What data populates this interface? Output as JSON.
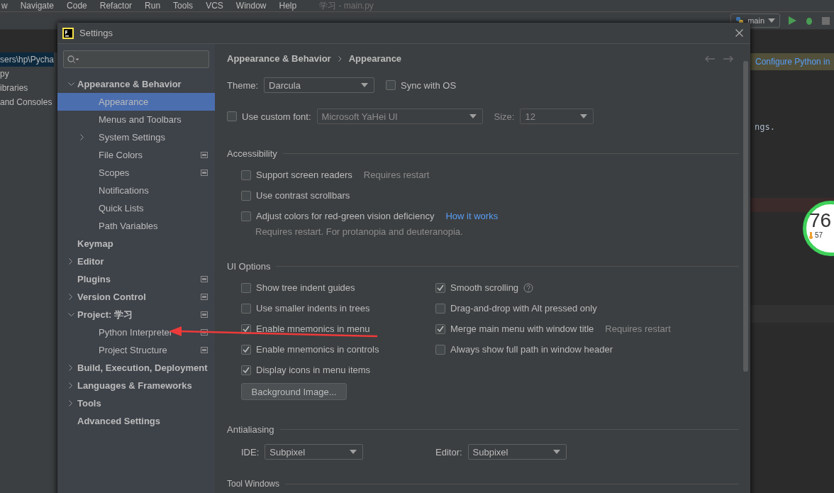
{
  "ide": {
    "menu": [
      "w",
      "Navigate",
      "Code",
      "Refactor",
      "Run",
      "Tools",
      "VCS",
      "Window",
      "Help"
    ],
    "window_title": "学习 - main.py",
    "run_config": "main",
    "project_tree": [
      {
        "label": "sers\\hp\\Pycha",
        "selected": true
      },
      {
        "label": "py",
        "selected": false
      },
      {
        "label": "ibraries",
        "selected": false
      },
      {
        "label": "and Consoles",
        "selected": false
      }
    ],
    "banner_link": "Configure Python in",
    "editor_text": "ngs.",
    "gauge": {
      "value": "76",
      "sub": "57"
    }
  },
  "dialog": {
    "title": "Settings"
  },
  "sidebar": {
    "items": [
      {
        "label": "Appearance & Behavior",
        "selected": false,
        "project_level": false,
        "expanded": true,
        "children": [
          {
            "label": "Appearance",
            "selected": true,
            "project_level": false
          },
          {
            "label": "Menus and Toolbars",
            "selected": false,
            "project_level": false
          },
          {
            "label": "System Settings",
            "selected": false,
            "project_level": false,
            "expanded": false
          },
          {
            "label": "File Colors",
            "selected": false,
            "project_level": true
          },
          {
            "label": "Scopes",
            "selected": false,
            "project_level": true
          },
          {
            "label": "Notifications",
            "selected": false,
            "project_level": false
          },
          {
            "label": "Quick Lists",
            "selected": false,
            "project_level": false
          },
          {
            "label": "Path Variables",
            "selected": false,
            "project_level": false
          }
        ]
      },
      {
        "label": "Keymap",
        "selected": false,
        "project_level": false
      },
      {
        "label": "Editor",
        "selected": false,
        "project_level": false,
        "expanded": false
      },
      {
        "label": "Plugins",
        "selected": false,
        "project_level": true
      },
      {
        "label": "Version Control",
        "selected": false,
        "project_level": true,
        "expanded": false
      },
      {
        "label": "Project: 学习",
        "selected": false,
        "project_level": true,
        "expanded": true,
        "children": [
          {
            "label": "Python Interpreter",
            "selected": false,
            "project_level": true
          },
          {
            "label": "Project Structure",
            "selected": false,
            "project_level": true
          }
        ]
      },
      {
        "label": "Build, Execution, Deployment",
        "selected": false,
        "project_level": false,
        "expanded": false
      },
      {
        "label": "Languages & Frameworks",
        "selected": false,
        "project_level": false,
        "expanded": false
      },
      {
        "label": "Tools",
        "selected": false,
        "project_level": false,
        "expanded": false
      },
      {
        "label": "Advanced Settings",
        "selected": false,
        "project_level": false
      }
    ]
  },
  "breadcrumb": [
    "Appearance & Behavior",
    "Appearance"
  ],
  "theme": {
    "label": "Theme:",
    "value": "Darcula"
  },
  "sync_with_os": {
    "label": "Sync with OS",
    "checked": false
  },
  "custom_font": {
    "label": "Use custom font:",
    "checked": false,
    "font": "Microsoft YaHei UI",
    "size_label": "Size:",
    "size": "12",
    "disabled": true
  },
  "accessibility": {
    "title": "Accessibility",
    "options": [
      {
        "label": "Support screen readers",
        "checked": false,
        "note": "Requires restart"
      },
      {
        "label": "Use contrast scrollbars",
        "checked": false
      },
      {
        "label": "Adjust colors for red-green vision deficiency",
        "checked": false,
        "link": "How it works",
        "detail": "Requires restart. For protanopia and deuteranopia."
      }
    ]
  },
  "ui_options": {
    "title": "UI Options",
    "left": [
      {
        "label": "Show tree indent guides",
        "checked": false
      },
      {
        "label": "Use smaller indents in trees",
        "checked": false
      },
      {
        "label": "Enable mnemonics in menu",
        "checked": true
      },
      {
        "label": "Enable mnemonics in controls",
        "checked": true
      },
      {
        "label": "Display icons in menu items",
        "checked": true
      }
    ],
    "right": [
      {
        "label": "Smooth scrolling",
        "checked": true,
        "help": true
      },
      {
        "label": "Drag-and-drop with Alt pressed only",
        "checked": false,
        "help": false
      },
      {
        "label": "Merge main menu with window title",
        "checked": true,
        "help": false,
        "note": "Requires restart"
      },
      {
        "label": "Always show full path in window header",
        "checked": false,
        "help": false
      }
    ],
    "button": "Background Image..."
  },
  "antialiasing": {
    "title": "Antialiasing",
    "fields": [
      {
        "label": "IDE:",
        "value": "Subpixel"
      },
      {
        "label": "Editor:",
        "value": "Subpixel"
      }
    ]
  },
  "tool_windows": {
    "title": "Tool Windows"
  }
}
